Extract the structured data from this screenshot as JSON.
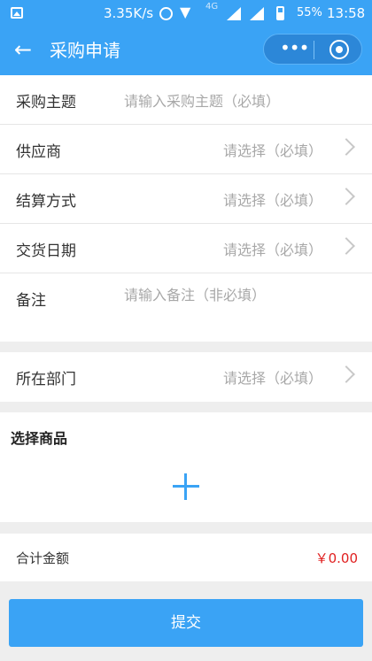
{
  "status_bar": {
    "speed": "3.35K/s",
    "network": "4G",
    "battery": "55%",
    "time": "13:58"
  },
  "navbar": {
    "back_glyph": "←",
    "title": "采购申请",
    "more_glyph": "•••"
  },
  "form": {
    "subject": {
      "label": "采购主题",
      "placeholder": "请输入采购主题（必填）"
    },
    "supplier": {
      "label": "供应商",
      "placeholder": "请选择（必填）"
    },
    "settlement": {
      "label": "结算方式",
      "placeholder": "请选择（必填）"
    },
    "delivery_date": {
      "label": "交货日期",
      "placeholder": "请选择（必填）"
    },
    "remark": {
      "label": "备注",
      "placeholder": "请输入备注（非必填）"
    },
    "department": {
      "label": "所在部门",
      "placeholder": "请选择（必填）"
    }
  },
  "goods": {
    "title": "选择商品"
  },
  "total": {
    "label": "合计金额",
    "value": "￥0.00"
  },
  "actions": {
    "submit_label": "提交"
  },
  "colors": {
    "brand": "#3aa3f5",
    "price": "#e02020"
  },
  "icons": [
    "gallery-icon",
    "alarm-icon",
    "wifi-icon",
    "signal-icon",
    "battery-icon",
    "back-arrow-icon",
    "more-icon",
    "target-icon",
    "chevron-right-icon",
    "plus-icon"
  ]
}
